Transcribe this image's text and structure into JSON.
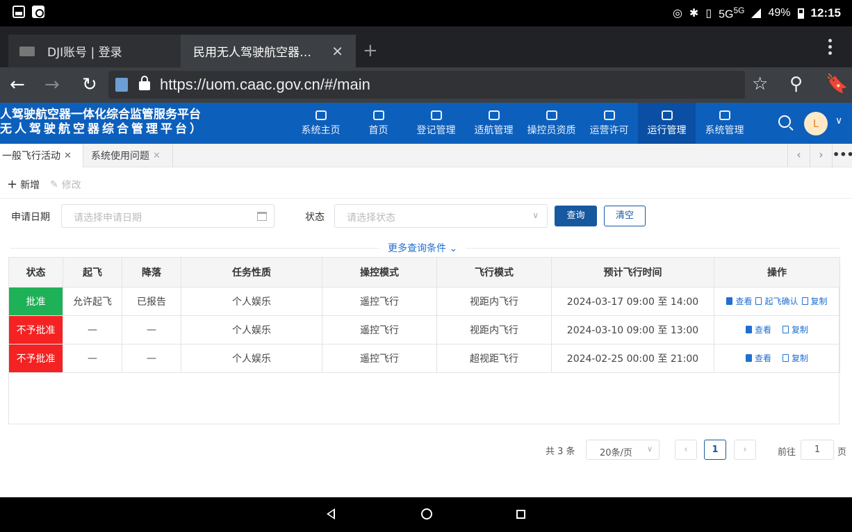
{
  "status_bar": {
    "network": "5G",
    "network_sup": "5G",
    "battery": "49%",
    "time": "12:15"
  },
  "browser": {
    "tabs": [
      {
        "title": "DJI账号 | 登录",
        "active": false
      },
      {
        "title": "民用无人驾驶航空器…",
        "active": true
      }
    ],
    "url": "https://uom.caac.gov.cn/#/main"
  },
  "header": {
    "title_line1": "人驾驶航空器一体化综合监管服务平台",
    "title_line2": "无人驾驶航空器综合管理平台）",
    "nav": [
      {
        "label": "系统主页",
        "icon": "window-icon"
      },
      {
        "label": "首页",
        "icon": "monitor-icon"
      },
      {
        "label": "登记管理",
        "icon": "document-icon"
      },
      {
        "label": "适航管理",
        "icon": "drone-icon"
      },
      {
        "label": "操控员资质",
        "icon": "shield-icon"
      },
      {
        "label": "运营许可",
        "icon": "id-card-icon"
      },
      {
        "label": "运行管理",
        "icon": "clipboard-icon",
        "active": true
      },
      {
        "label": "系统管理",
        "icon": "network-icon"
      }
    ],
    "avatar_letter": "L"
  },
  "page_tabs": [
    {
      "label": "一般飞行活动",
      "active": true
    },
    {
      "label": "系统使用问题",
      "active": false
    }
  ],
  "toolbar": {
    "add_label": "新增",
    "edit_label": "修改"
  },
  "filters": {
    "date_label": "申请日期",
    "date_placeholder": "请选择申请日期",
    "status_label": "状态",
    "status_placeholder": "请选择状态",
    "query_label": "查询",
    "clear_label": "清空",
    "more_label": "更多查询条件"
  },
  "table": {
    "columns": [
      "状态",
      "起飞",
      "降落",
      "任务性质",
      "操控模式",
      "飞行模式",
      "预计飞行时间",
      "操作"
    ],
    "rows": [
      {
        "status": "批准",
        "status_color": "#1fb157",
        "takeoff": "允许起飞",
        "landing": "已报告",
        "mission": "个人娱乐",
        "control": "遥控飞行",
        "flight_mode": "视距内飞行",
        "time": "2024-03-17 09:00 至 14:00",
        "actions": [
          "查看",
          "起飞确认",
          "复制"
        ]
      },
      {
        "status": "不予批准",
        "status_color": "#f42222",
        "takeoff": "—",
        "landing": "—",
        "mission": "个人娱乐",
        "control": "遥控飞行",
        "flight_mode": "视距内飞行",
        "time": "2024-03-10 09:00 至 13:00",
        "actions": [
          "查看",
          "复制"
        ]
      },
      {
        "status": "不予批准",
        "status_color": "#f42222",
        "takeoff": "—",
        "landing": "—",
        "mission": "个人娱乐",
        "control": "遥控飞行",
        "flight_mode": "超视距飞行",
        "time": "2024-02-25 00:00 至 21:00",
        "actions": [
          "查看",
          "复制"
        ]
      }
    ]
  },
  "pagination": {
    "total_text": "共 3 条",
    "page_size": "20条/页",
    "current_page": "1",
    "goto_label": "前往",
    "goto_value": "1",
    "page_suffix": "页"
  }
}
